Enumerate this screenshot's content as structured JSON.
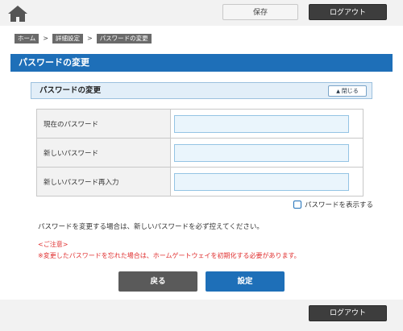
{
  "header": {
    "save_label": "保存",
    "logout_label": "ログアウト"
  },
  "breadcrumb": [
    {
      "label": "ホーム"
    },
    {
      "label": "詳細設定"
    },
    {
      "label": "パスワードの変更"
    }
  ],
  "breadcrumb_separator": ">",
  "page_title": "パスワードの変更",
  "panel": {
    "title": "パスワードの変更",
    "close_label": "閉じる"
  },
  "form": {
    "rows": [
      {
        "label": "現在のパスワード",
        "value": ""
      },
      {
        "label": "新しいパスワード",
        "value": ""
      },
      {
        "label": "新しいパスワード再入力",
        "value": ""
      }
    ],
    "show_password_label": "パスワードを表示する",
    "show_password_checked": false
  },
  "note": "パスワードを変更する場合は、新しいパスワードを必ず控えてください。",
  "caution": {
    "heading": "<ご注意>",
    "text": "※変更したパスワードを忘れた場合は、ホームゲートウェイを初期化する必要があります。"
  },
  "buttons": {
    "back_label": "戻る",
    "set_label": "設定"
  },
  "footer": {
    "logout_label": "ログアウト"
  },
  "colors": {
    "accent": "#1e6fb8",
    "caution": "#e03030",
    "dark_button": "#3d3d3d"
  }
}
